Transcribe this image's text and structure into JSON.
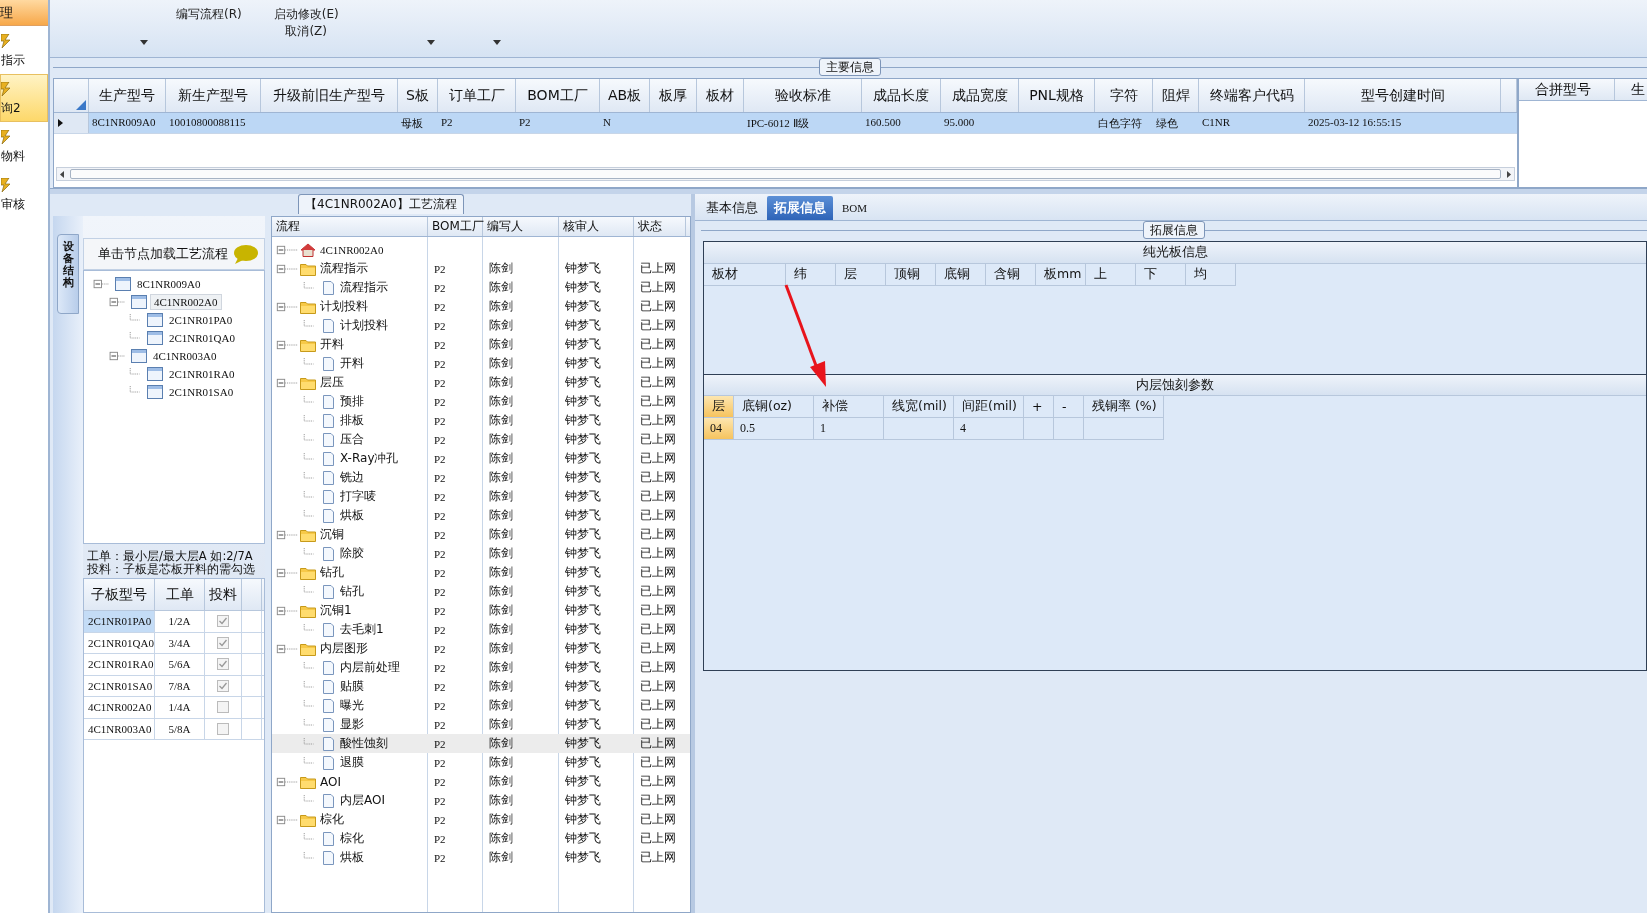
{
  "sidebar": {
    "header": "理",
    "items": [
      {
        "label": "指示",
        "selected": false
      },
      {
        "label": "询2",
        "selected": true
      },
      {
        "label": "物料",
        "selected": false
      },
      {
        "label": "审核",
        "selected": false
      }
    ]
  },
  "toolbar": {
    "buttons": [
      {
        "label": "编写流程(R)"
      },
      {
        "label": "启动修改(E)",
        "sublabel": "取消(Z)"
      }
    ]
  },
  "main_info": {
    "title": "主要信息",
    "columns": [
      "生产型号",
      "新生产型号",
      "升级前旧生产型号",
      "S板",
      "订单工厂",
      "BOM工厂",
      "AB板",
      "板厚",
      "板材",
      "验收标准",
      "成品长度",
      "成品宽度",
      "PNL规格",
      "字符",
      "阻焊",
      "终端客户代码",
      "型号创建时间"
    ],
    "rows": [
      {
        "selected": true,
        "cells": [
          "8C1NR009A0",
          "10010800088115",
          "",
          "母板",
          "P2",
          "P2",
          "N",
          "",
          "",
          "IPC-6012 Ⅱ级",
          "160.500",
          "95.000",
          "",
          "白色字符",
          "绿色",
          "C1NR",
          "2025-03-12 16:55:15"
        ]
      }
    ],
    "side_columns": [
      "合拼型号",
      "生"
    ]
  },
  "structure": {
    "tab": "设备结构",
    "hint": "单击节点加载工艺流程",
    "tree": [
      {
        "label": "8C1NR009A0",
        "expanded": true,
        "selected": false,
        "children": [
          {
            "label": "4C1NR002A0",
            "expanded": true,
            "selected": true,
            "children": [
              {
                "label": "2C1NR01PA0",
                "selected": false
              },
              {
                "label": "2C1NR01QA0",
                "selected": false
              }
            ]
          },
          {
            "label": "4C1NR003A0",
            "expanded": true,
            "selected": false,
            "children": [
              {
                "label": "2C1NR01RA0",
                "selected": false
              },
              {
                "label": "2C1NR01SA0",
                "selected": false
              }
            ]
          }
        ]
      }
    ],
    "note_lines": [
      "工单：最小层/最大层A 如:2/7A",
      "投料：子板是芯板开料的需勾选"
    ],
    "columns": [
      "子板型号",
      "工单",
      "投料"
    ],
    "rows": [
      {
        "board": "2C1NR01PA0",
        "order": "1/2A",
        "checked": true,
        "selected": true
      },
      {
        "board": "2C1NR01QA0",
        "order": "3/4A",
        "checked": true,
        "selected": false
      },
      {
        "board": "2C1NR01RA0",
        "order": "5/6A",
        "checked": true,
        "selected": false
      },
      {
        "board": "2C1NR01SA0",
        "order": "7/8A",
        "checked": true,
        "selected": false
      },
      {
        "board": "4C1NR002A0",
        "order": "1/4A",
        "checked": false,
        "selected": false
      },
      {
        "board": "4C1NR003A0",
        "order": "5/8A",
        "checked": false,
        "selected": false
      }
    ]
  },
  "flow": {
    "title": "【4C1NR002A0】工艺流程",
    "columns": [
      "流程",
      "BOM工厂",
      "编写人",
      "核审人",
      "状态"
    ],
    "root": {
      "label": "4C1NR002A0",
      "expanded": true,
      "children": [
        {
          "label": "流程指示",
          "bom": "P2",
          "writer": "陈剑",
          "reviewer": "钟梦飞",
          "status": "已上网",
          "expanded": true,
          "selected": false,
          "children": [
            {
              "label": "流程指示",
              "bom": "P2",
              "writer": "陈剑",
              "reviewer": "钟梦飞",
              "status": "已上网",
              "selected": false
            }
          ]
        },
        {
          "label": "计划投料",
          "bom": "P2",
          "writer": "陈剑",
          "reviewer": "钟梦飞",
          "status": "已上网",
          "expanded": true,
          "selected": false,
          "children": [
            {
              "label": "计划投料",
              "bom": "P2",
              "writer": "陈剑",
              "reviewer": "钟梦飞",
              "status": "已上网",
              "selected": false
            }
          ]
        },
        {
          "label": "开料",
          "bom": "P2",
          "writer": "陈剑",
          "reviewer": "钟梦飞",
          "status": "已上网",
          "expanded": true,
          "selected": false,
          "children": [
            {
              "label": "开料",
              "bom": "P2",
              "writer": "陈剑",
              "reviewer": "钟梦飞",
              "status": "已上网",
              "selected": false
            }
          ]
        },
        {
          "label": "层压",
          "bom": "P2",
          "writer": "陈剑",
          "reviewer": "钟梦飞",
          "status": "已上网",
          "expanded": true,
          "selected": false,
          "children": [
            {
              "label": "预排",
              "bom": "P2",
              "writer": "陈剑",
              "reviewer": "钟梦飞",
              "status": "已上网",
              "selected": false
            },
            {
              "label": "排板",
              "bom": "P2",
              "writer": "陈剑",
              "reviewer": "钟梦飞",
              "status": "已上网",
              "selected": false
            },
            {
              "label": "压合",
              "bom": "P2",
              "writer": "陈剑",
              "reviewer": "钟梦飞",
              "status": "已上网",
              "selected": false
            },
            {
              "label": "X-Ray冲孔",
              "bom": "P2",
              "writer": "陈剑",
              "reviewer": "钟梦飞",
              "status": "已上网",
              "selected": false
            },
            {
              "label": "铣边",
              "bom": "P2",
              "writer": "陈剑",
              "reviewer": "钟梦飞",
              "status": "已上网",
              "selected": false
            },
            {
              "label": "打字唛",
              "bom": "P2",
              "writer": "陈剑",
              "reviewer": "钟梦飞",
              "status": "已上网",
              "selected": false
            },
            {
              "label": "烘板",
              "bom": "P2",
              "writer": "陈剑",
              "reviewer": "钟梦飞",
              "status": "已上网",
              "selected": false
            }
          ]
        },
        {
          "label": "沉铜",
          "bom": "P2",
          "writer": "陈剑",
          "reviewer": "钟梦飞",
          "status": "已上网",
          "expanded": true,
          "selected": false,
          "children": [
            {
              "label": "除胶",
              "bom": "P2",
              "writer": "陈剑",
              "reviewer": "钟梦飞",
              "status": "已上网",
              "selected": false
            }
          ]
        },
        {
          "label": "钻孔",
          "bom": "P2",
          "writer": "陈剑",
          "reviewer": "钟梦飞",
          "status": "已上网",
          "expanded": true,
          "selected": false,
          "children": [
            {
              "label": "钻孔",
              "bom": "P2",
              "writer": "陈剑",
              "reviewer": "钟梦飞",
              "status": "已上网",
              "selected": false
            }
          ]
        },
        {
          "label": "沉铜1",
          "bom": "P2",
          "writer": "陈剑",
          "reviewer": "钟梦飞",
          "status": "已上网",
          "expanded": true,
          "selected": false,
          "children": [
            {
              "label": "去毛刺1",
              "bom": "P2",
              "writer": "陈剑",
              "reviewer": "钟梦飞",
              "status": "已上网",
              "selected": false
            }
          ]
        },
        {
          "label": "内层图形",
          "bom": "P2",
          "writer": "陈剑",
          "reviewer": "钟梦飞",
          "status": "已上网",
          "expanded": true,
          "selected": false,
          "children": [
            {
              "label": "内层前处理",
              "bom": "P2",
              "writer": "陈剑",
              "reviewer": "钟梦飞",
              "status": "已上网",
              "selected": false
            },
            {
              "label": "贴膜",
              "bom": "P2",
              "writer": "陈剑",
              "reviewer": "钟梦飞",
              "status": "已上网",
              "selected": false
            },
            {
              "label": "曝光",
              "bom": "P2",
              "writer": "陈剑",
              "reviewer": "钟梦飞",
              "status": "已上网",
              "selected": false
            },
            {
              "label": "显影",
              "bom": "P2",
              "writer": "陈剑",
              "reviewer": "钟梦飞",
              "status": "已上网",
              "selected": false
            },
            {
              "label": "酸性蚀刻",
              "bom": "P2",
              "writer": "陈剑",
              "reviewer": "钟梦飞",
              "status": "已上网",
              "selected": true
            },
            {
              "label": "退膜",
              "bom": "P2",
              "writer": "陈剑",
              "reviewer": "钟梦飞",
              "status": "已上网",
              "selected": false
            }
          ]
        },
        {
          "label": "AOI",
          "bom": "P2",
          "writer": "陈剑",
          "reviewer": "钟梦飞",
          "status": "已上网",
          "expanded": true,
          "selected": false,
          "children": [
            {
              "label": "内层AOI",
              "bom": "P2",
              "writer": "陈剑",
              "reviewer": "钟梦飞",
              "status": "已上网",
              "selected": false
            }
          ]
        },
        {
          "label": "棕化",
          "bom": "P2",
          "writer": "陈剑",
          "reviewer": "钟梦飞",
          "status": "已上网",
          "expanded": true,
          "selected": false,
          "children": [
            {
              "label": "棕化",
              "bom": "P2",
              "writer": "陈剑",
              "reviewer": "钟梦飞",
              "status": "已上网",
              "selected": false
            },
            {
              "label": "烘板",
              "bom": "P2",
              "writer": "陈剑",
              "reviewer": "钟梦飞",
              "status": "已上网",
              "selected": false
            }
          ]
        }
      ]
    }
  },
  "details": {
    "tabs": [
      {
        "label": "基本信息",
        "selected": false
      },
      {
        "label": "拓展信息",
        "selected": true
      },
      {
        "label": "BOM",
        "selected": false
      }
    ],
    "group_title": "拓展信息",
    "bare_board": {
      "title": "纯光板信息",
      "columns": [
        "板材",
        "纬",
        "层",
        "顶铜",
        "底铜",
        "含铜",
        "板mm",
        "上",
        "下",
        "均"
      ]
    },
    "etching": {
      "title": "内层蚀刻参数",
      "columns": [
        "层",
        "底铜(oz)",
        "补偿",
        "线宽(mil)",
        "间距(mil)",
        "+",
        "-",
        "残铜率 (%)"
      ],
      "rows": [
        {
          "cells": [
            "04",
            "0.5",
            "1",
            "",
            "4",
            "",
            "",
            ""
          ]
        }
      ]
    }
  }
}
